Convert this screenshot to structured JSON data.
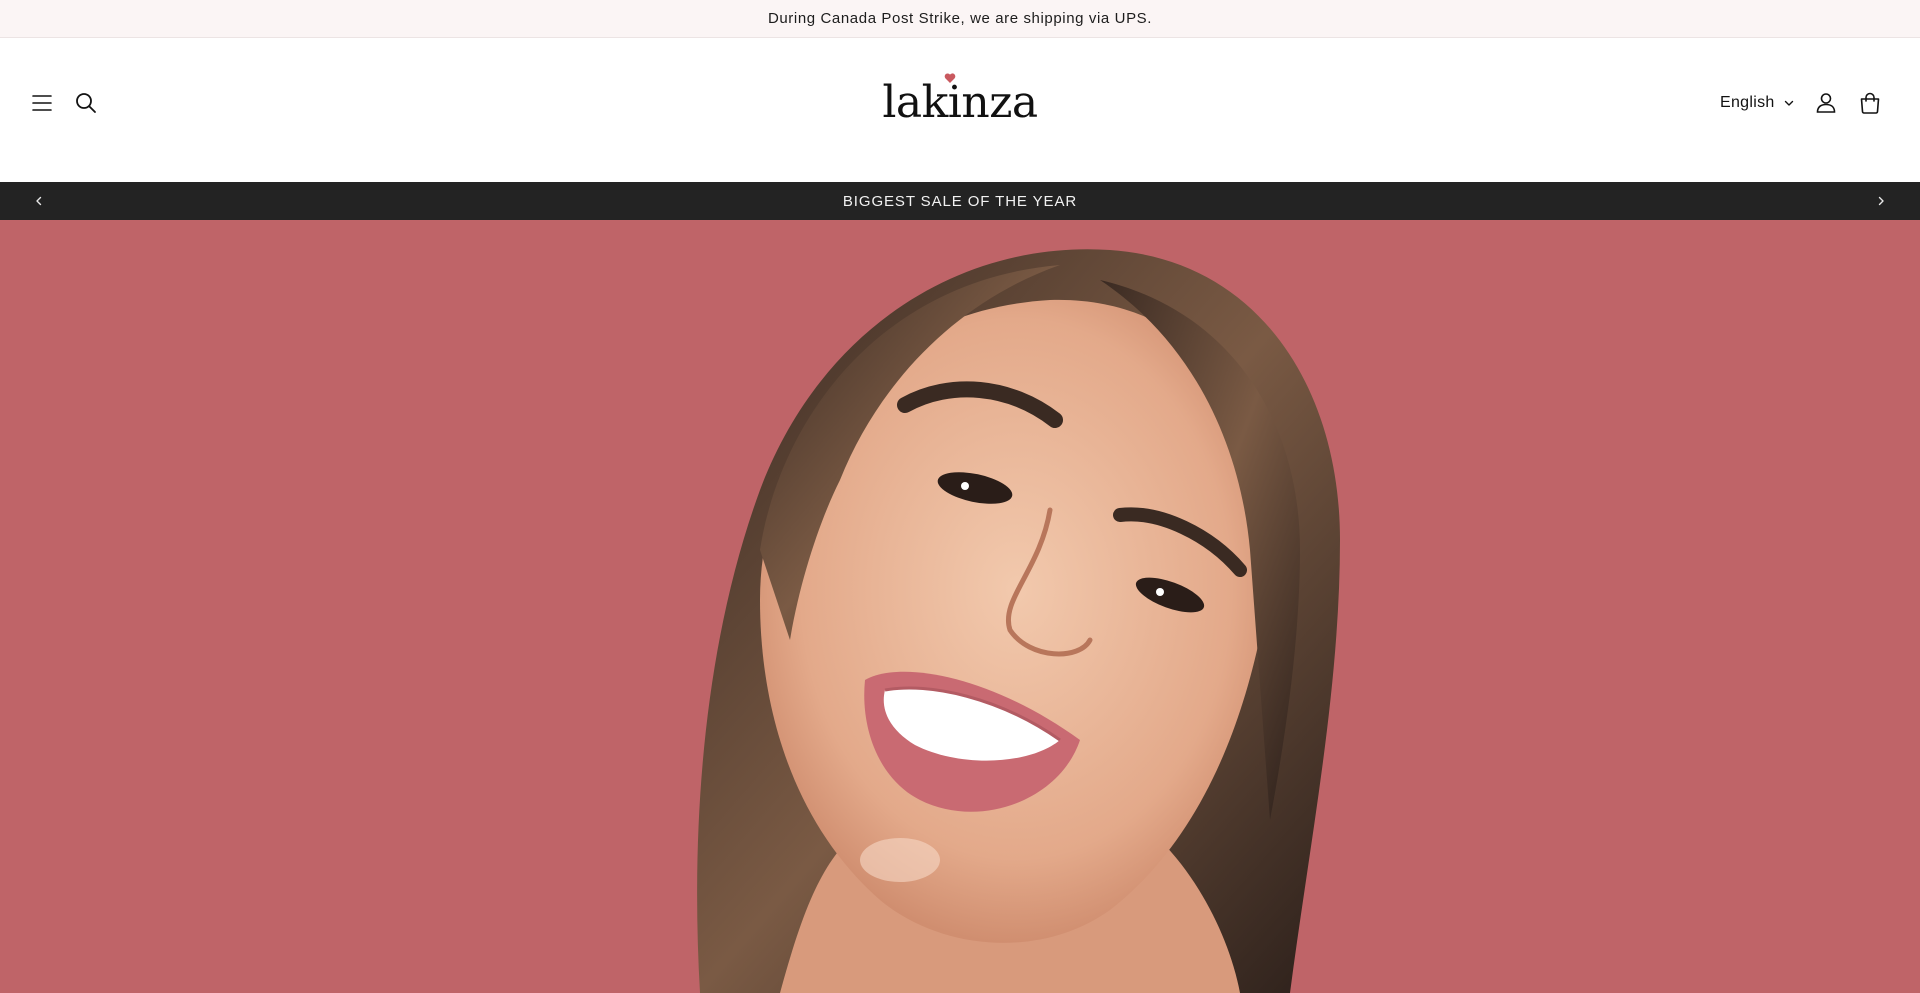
{
  "announcement": {
    "text": "During Canada Post Strike, we are shipping via UPS."
  },
  "header": {
    "logo_text": "lakinza",
    "language": "English",
    "icons": [
      "menu-icon",
      "search-icon",
      "account-icon",
      "cart-icon"
    ]
  },
  "slider": {
    "text": "BIGGEST SALE OF THE YEAR",
    "prev_icon": "chevron-left-icon",
    "next_icon": "chevron-right-icon"
  },
  "hero": {
    "background_color": "#bf6468",
    "image": "smiling-woman-photo"
  },
  "colors": {
    "announcement_bg": "#fbf5f5",
    "slider_bg": "#232323",
    "logo_heart": "#c9595f"
  }
}
